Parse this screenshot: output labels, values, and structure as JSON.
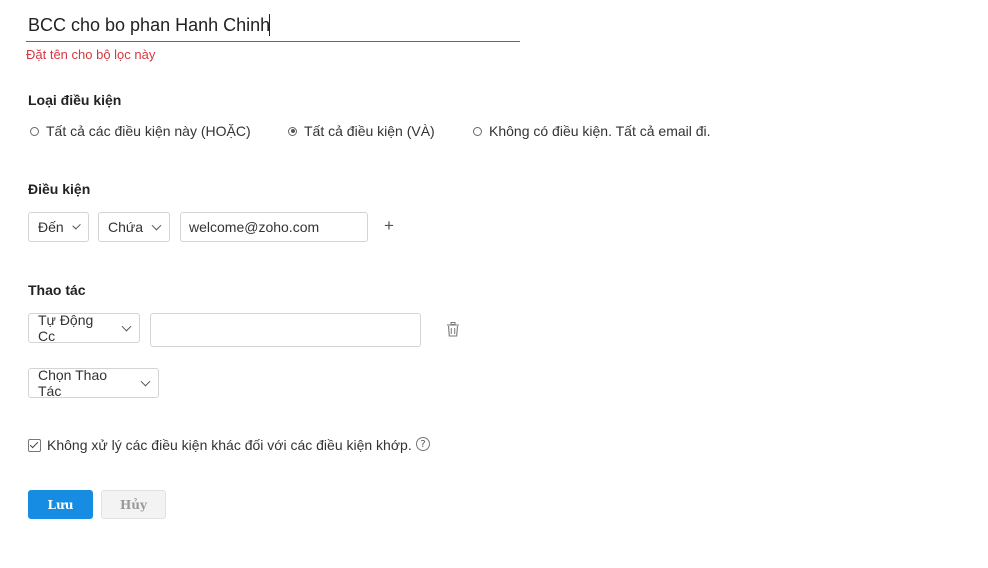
{
  "filter": {
    "name_value": "BCC cho bo phan Hanh Chinh",
    "name_hint": "Đặt tên cho bộ lọc này"
  },
  "condition_type": {
    "title": "Loại điều kiện",
    "options": [
      {
        "label": "Tất cả các điều kiện này (HOẶC)",
        "selected": false
      },
      {
        "label": "Tất cả điều kiện (VÀ)",
        "selected": true
      },
      {
        "label": "Không có điều kiện. Tất cả email đi.",
        "selected": false
      }
    ]
  },
  "conditions": {
    "title": "Điều kiện",
    "field_value": "Đến",
    "operator_value": "Chứa",
    "text_value": "welcome@zoho.com",
    "add_label": "+"
  },
  "actions": {
    "title": "Thao tác",
    "action_value": "Tự Động Cc",
    "action_input_value": "",
    "choose_action_label": "Chọn Thao Tác"
  },
  "options": {
    "stop_processing_label": "Không xử lý các điều kiện khác đối với các điều kiện khớp.",
    "stop_processing_checked": true,
    "help_glyph": "?"
  },
  "buttons": {
    "save_label": "Lưu",
    "cancel_label": "Hủy"
  },
  "colors": {
    "accent": "#168de2",
    "error": "#d9363e"
  },
  "icons": {
    "delete": "trash-icon",
    "help": "help-icon",
    "dropdown": "chevron-down-icon"
  }
}
